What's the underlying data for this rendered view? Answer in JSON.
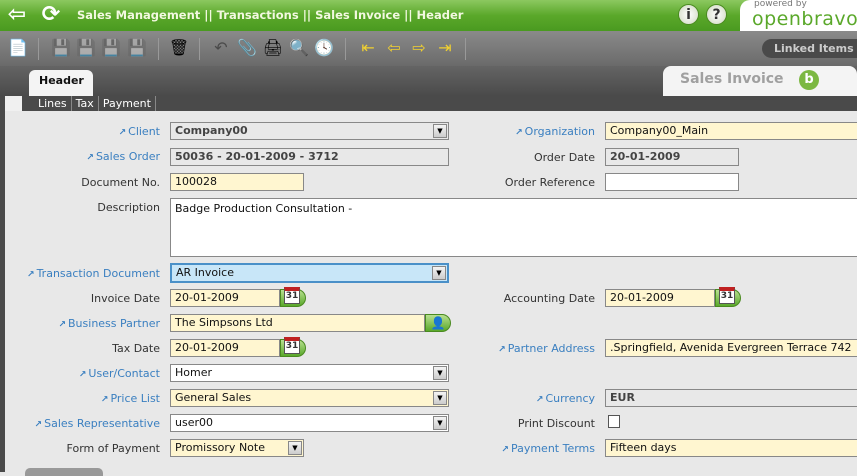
{
  "header": {
    "breadcrumb": "Sales Management || Transactions || Sales Invoice  ||  Header",
    "powered_by": "powered by",
    "brand": "openbravo",
    "info": "i",
    "help": "?"
  },
  "toolbar": {
    "linked_items": "Linked Items"
  },
  "tabs": {
    "active": "Header",
    "window_title": "Sales Invoice",
    "subtabs": [
      "Lines",
      "Tax",
      "Payment"
    ]
  },
  "form": {
    "client": {
      "label": "Client",
      "value": "Company00"
    },
    "organization": {
      "label": "Organization",
      "value": "Company00_Main"
    },
    "sales_order": {
      "label": "Sales Order",
      "value": "50036 - 20-01-2009 - 3712"
    },
    "order_date": {
      "label": "Order Date",
      "value": "20-01-2009"
    },
    "document_no": {
      "label": "Document No.",
      "value": "100028"
    },
    "order_reference": {
      "label": "Order Reference",
      "value": ""
    },
    "description": {
      "label": "Description",
      "value": "Badge Production Consultation -"
    },
    "transaction_document": {
      "label": "Transaction Document",
      "value": "AR Invoice"
    },
    "invoice_date": {
      "label": "Invoice Date",
      "value": "20-01-2009"
    },
    "accounting_date": {
      "label": "Accounting Date",
      "value": "20-01-2009"
    },
    "business_partner": {
      "label": "Business Partner",
      "value": "The Simpsons Ltd"
    },
    "tax_date": {
      "label": "Tax Date",
      "value": "20-01-2009"
    },
    "partner_address": {
      "label": "Partner Address",
      "value": ".Springfield, Avenida Evergreen Terrace 742"
    },
    "user_contact": {
      "label": "User/Contact",
      "value": "Homer"
    },
    "price_list": {
      "label": "Price List",
      "value": "General Sales"
    },
    "currency": {
      "label": "Currency",
      "value": "EUR"
    },
    "sales_rep": {
      "label": "Sales Representative",
      "value": "user00"
    },
    "print_discount": {
      "label": "Print Discount",
      "checked": false
    },
    "form_of_payment": {
      "label": "Form of Payment",
      "value": "Promissory Note"
    },
    "payment_terms": {
      "label": "Payment Terms",
      "value": "Fifteen days"
    },
    "calendar_day": "31"
  }
}
